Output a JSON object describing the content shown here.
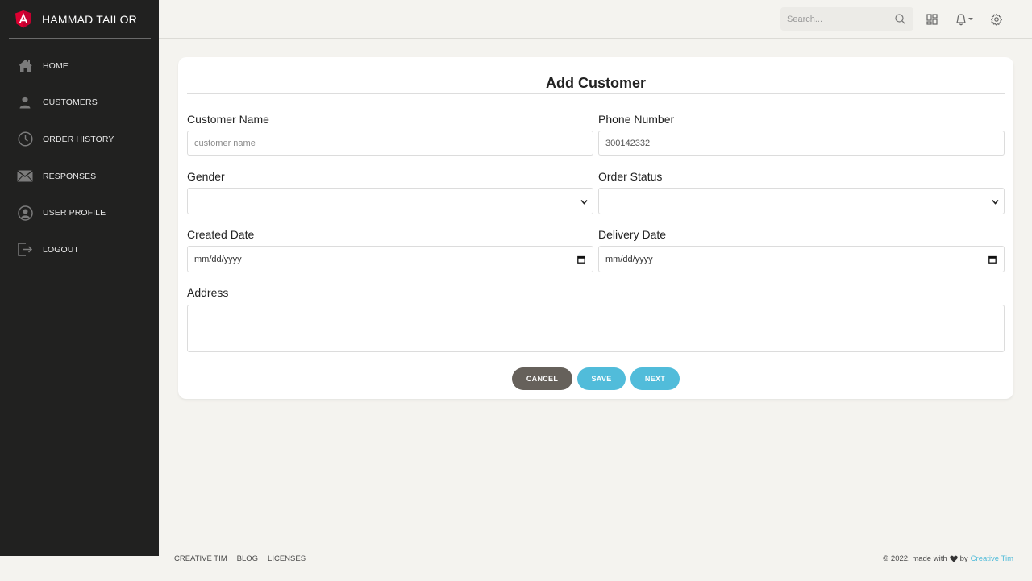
{
  "brand": {
    "name": "HAMMAD TAILOR",
    "logo_icon": "angular-logo-icon",
    "logo_color": "#dd0031"
  },
  "sidebar": {
    "items": [
      {
        "label": "HOME",
        "icon": "home-icon"
      },
      {
        "label": "CUSTOMERS",
        "icon": "user-icon"
      },
      {
        "label": "ORDER HISTORY",
        "icon": "clock-icon"
      },
      {
        "label": "RESPONSES",
        "icon": "envelope-icon"
      },
      {
        "label": "USER PROFILE",
        "icon": "user-circle-icon"
      },
      {
        "label": "LOGOUT",
        "icon": "logout-icon"
      }
    ]
  },
  "topbar": {
    "search_placeholder": "Search...",
    "icons": [
      "search-icon",
      "dashboard-icon",
      "bell-icon",
      "gear-icon"
    ]
  },
  "form": {
    "title": "Add Customer",
    "customer_name": {
      "label": "Customer Name",
      "placeholder": "customer name",
      "value": ""
    },
    "phone_number": {
      "label": "Phone Number",
      "placeholder": "",
      "value": "300142332"
    },
    "gender": {
      "label": "Gender",
      "value": ""
    },
    "order_status": {
      "label": "Order Status",
      "value": ""
    },
    "created_date": {
      "label": "Created Date",
      "value": "mm/dd/yyyy"
    },
    "delivery_date": {
      "label": "Delivery Date",
      "value": "mm/dd/yyyy"
    },
    "address": {
      "label": "Address",
      "value": ""
    },
    "buttons": {
      "cancel": "CANCEL",
      "save": "SAVE",
      "next": "NEXT"
    }
  },
  "footer": {
    "links": [
      "CREATIVE TIM",
      "BLOG",
      "LICENSES"
    ],
    "copyright_prefix": "© 2022, made with",
    "copyright_by": "by",
    "copyright_link": "Creative Tim"
  },
  "colors": {
    "sidebar_bg": "#212120",
    "page_bg": "#f4f3ef",
    "accent": "#51bcda",
    "cancel_btn": "#66615b"
  }
}
